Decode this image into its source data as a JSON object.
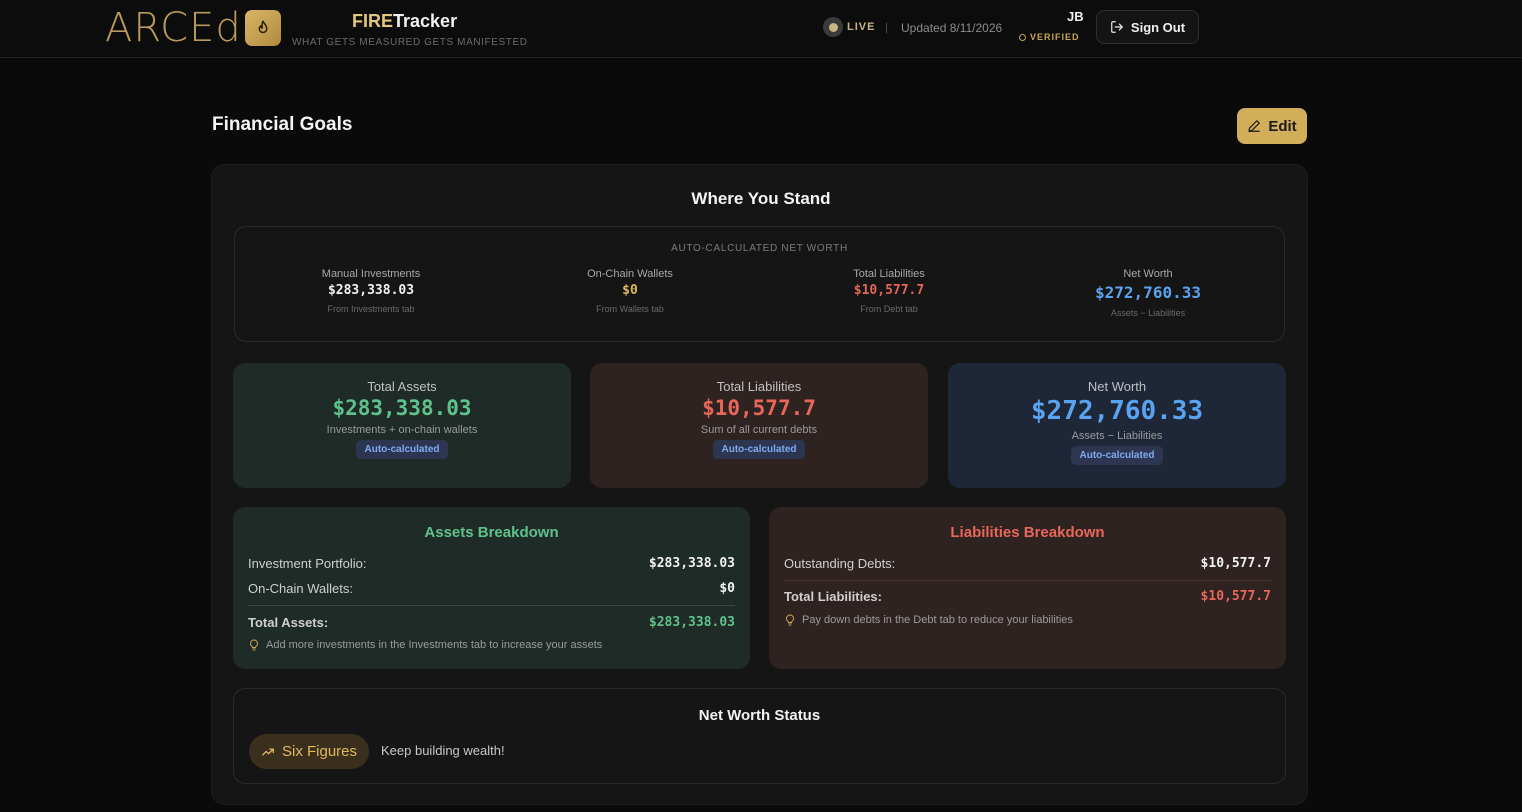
{
  "header": {
    "logo_text": "ARCEd",
    "brand_fire": "FIRE",
    "brand_tracker": "Tracker",
    "tagline": "WHAT GETS MEASURED GETS MANIFESTED",
    "live_label": "LIVE",
    "separator": "|",
    "updated": "Updated 8/11/2026",
    "user_initials": "JB",
    "verified_label": "VERIFIED",
    "sign_out_label": "Sign Out",
    "icons": [
      "flame-icon",
      "sign-out-icon"
    ]
  },
  "page": {
    "title": "Financial Goals",
    "edit_label": "Edit"
  },
  "where_you_stand": {
    "title": "Where You Stand",
    "auto_label": "AUTO-CALCULATED NET WORTH",
    "columns": [
      {
        "label": "Manual Investments",
        "value": "$283,338.03",
        "source": "From Investments tab",
        "color": "#f2f2f2"
      },
      {
        "label": "On-Chain Wallets",
        "value": "$0",
        "source": "From Wallets tab",
        "color": "#e0b85a"
      },
      {
        "label": "Total Liabilities",
        "value": "$10,577.7",
        "source": "From Debt tab",
        "color": "#e0675a"
      },
      {
        "label": "Net Worth",
        "value": "$272,760.33",
        "source": "Assets − Liabilities",
        "color": "#5aa3f0"
      }
    ]
  },
  "summary": {
    "assets": {
      "label": "Total Assets",
      "value": "$283,338.03",
      "desc": "Investments + on-chain wallets",
      "pill": "Auto-calculated",
      "color": "#5fc28c"
    },
    "liabilities": {
      "label": "Total Liabilities",
      "value": "$10,577.7",
      "desc": "Sum of all current debts",
      "pill": "Auto-calculated",
      "color": "#e8675a"
    },
    "net_worth": {
      "label": "Net Worth",
      "value": "$272,760.33",
      "desc": "Assets − Liabilities",
      "pill": "Auto-calculated",
      "color": "#5aa3f0"
    }
  },
  "assets_breakdown": {
    "title": "Assets Breakdown",
    "rows": [
      {
        "label": "Investment Portfolio:",
        "value": "$283,338.03"
      },
      {
        "label": "On-Chain Wallets:",
        "value": "$0"
      }
    ],
    "total_label": "Total Assets:",
    "total_value": "$283,338.03",
    "tip": "Add more investments in the Investments tab to increase your assets"
  },
  "liabilities_breakdown": {
    "title": "Liabilities Breakdown",
    "rows": [
      {
        "label": "Outstanding Debts:",
        "value": "$10,577.7"
      }
    ],
    "total_label": "Total Liabilities:",
    "total_value": "$10,577.7",
    "tip": "Pay down debts in the Debt tab to reduce your liabilities"
  },
  "status": {
    "title": "Net Worth Status",
    "badge": "Six Figures",
    "message": "Keep building wealth!"
  }
}
